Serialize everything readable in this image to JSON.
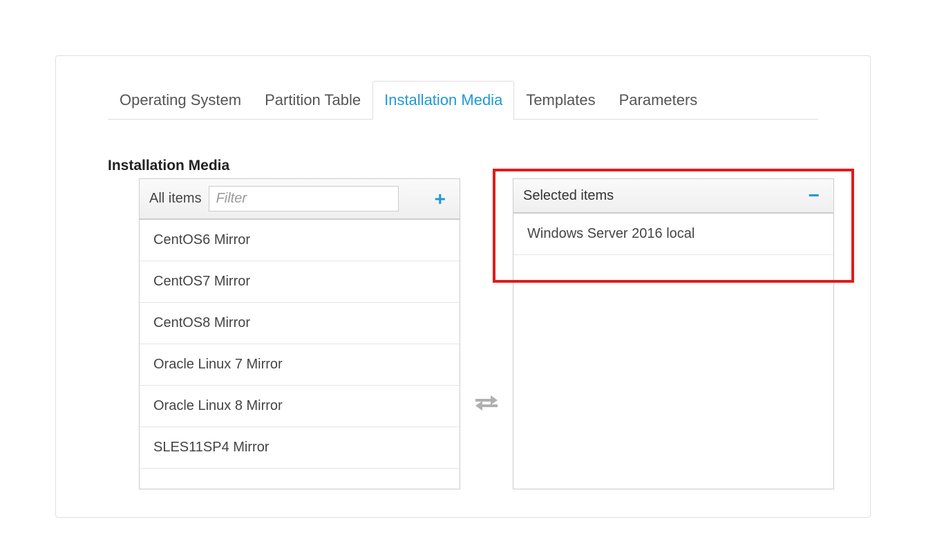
{
  "tabs": {
    "items": [
      {
        "label": "Operating System"
      },
      {
        "label": "Partition Table"
      },
      {
        "label": "Installation Media"
      },
      {
        "label": "Templates"
      },
      {
        "label": "Parameters"
      }
    ],
    "active_index": 2
  },
  "section": {
    "title": "Installation Media"
  },
  "available": {
    "header_label": "All items",
    "filter_placeholder": "Filter",
    "items": [
      "CentOS6 Mirror",
      "CentOS7 Mirror",
      "CentOS8 Mirror",
      "Oracle Linux 7 Mirror",
      "Oracle Linux 8 Mirror",
      "SLES11SP4 Mirror"
    ]
  },
  "selected": {
    "header_label": "Selected items",
    "items": [
      "Windows Server 2016 local"
    ]
  }
}
